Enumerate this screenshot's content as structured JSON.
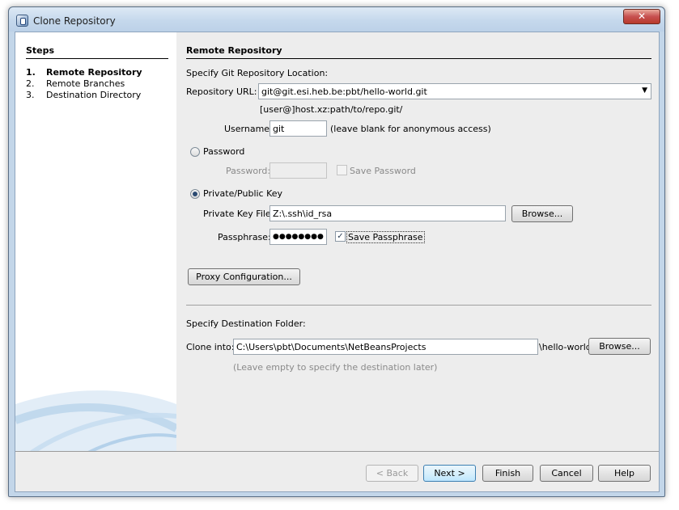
{
  "window": {
    "title": "Clone Repository",
    "close_glyph": "✕"
  },
  "steps": {
    "title": "Steps",
    "items": [
      {
        "num": "1.",
        "label": "Remote Repository",
        "active": true
      },
      {
        "num": "2.",
        "label": "Remote Branches",
        "active": false
      },
      {
        "num": "3.",
        "label": "Destination Directory",
        "active": false
      }
    ]
  },
  "remote": {
    "section_title": "Remote Repository",
    "location_label": "Specify Git Repository Location:",
    "url_label": "Repository URL:",
    "url_value": "git@git.esi.heb.be:pbt/hello-world.git",
    "url_hint": "[user@]host.xz:path/to/repo.git/",
    "username_label": "Username:",
    "username_value": "git",
    "username_hint": "(leave blank for anonymous access)",
    "password_radio": "Password",
    "password_label": "Password:",
    "save_password": "Save Password",
    "key_radio": "Private/Public Key",
    "key_file_label": "Private Key File:",
    "key_file_value": "Z:\\.ssh\\id_rsa",
    "browse_label": "Browse...",
    "passphrase_label": "Passphrase:",
    "passphrase_value": "●●●●●●●●",
    "save_passphrase": "Save Passphrase",
    "proxy_button": "Proxy Configuration..."
  },
  "destination": {
    "label": "Specify Destination Folder:",
    "clone_label": "Clone into:",
    "clone_value": "C:\\Users\\pbt\\Documents\\NetBeansProjects",
    "suffix": "\\hello-world",
    "browse_label": "Browse...",
    "hint": "(Leave empty to specify the destination later)"
  },
  "footer": {
    "back": "< Back",
    "next": "Next >",
    "finish": "Finish",
    "cancel": "Cancel",
    "help": "Help"
  },
  "colors": {
    "accent": "#3c7fb1",
    "titlebar": "#c5d8ec",
    "panel": "#ededed"
  }
}
